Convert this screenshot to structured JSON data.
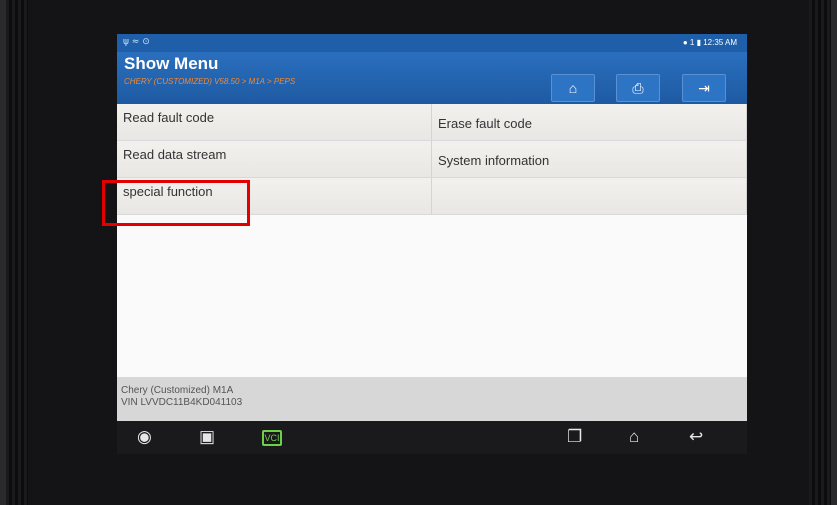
{
  "status": {
    "left_icons": "ψ ≈ ⊙",
    "right": "● 1 ▮ 12:35 AM"
  },
  "header": {
    "title": "Show Menu",
    "breadcrumb": "CHERY (CUSTOMIZED) V58.50 > M1A > PEPS",
    "buttons": [
      {
        "icon": "home-icon",
        "glyph": "⌂"
      },
      {
        "icon": "print-icon",
        "glyph": "⎙"
      },
      {
        "icon": "exit-icon",
        "glyph": "⇥"
      }
    ]
  },
  "menu": {
    "items": [
      {
        "label": "Read fault code"
      },
      {
        "label": "Erase fault code"
      },
      {
        "label": "Read data stream"
      },
      {
        "label": "System information"
      },
      {
        "label": "special function"
      },
      {
        "label": ""
      }
    ]
  },
  "footer": {
    "vehicle": "Chery (Customized) M1A",
    "vin": "VIN LVVDC11B4KD041103"
  },
  "nav": {
    "vci_label": "VCI",
    "icons": [
      "browser-icon",
      "gallery-icon",
      "vci-icon",
      "recent-apps-icon",
      "home-nav-icon",
      "back-icon"
    ]
  },
  "colors": {
    "header_blue": "#1e5aa2",
    "breadcrumb_orange": "#f08a36",
    "highlight_red": "#e30000",
    "vci_green": "#6fcf4a"
  }
}
